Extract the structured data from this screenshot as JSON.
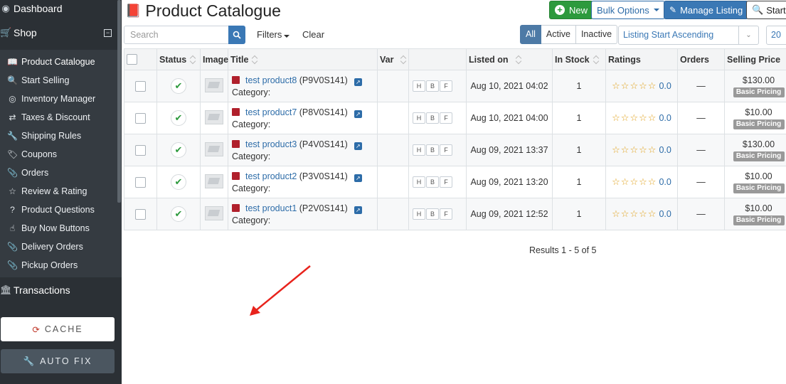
{
  "sidebar": {
    "dashboard": "Dashboard",
    "shop": "Shop",
    "items": [
      {
        "label": "Product Catalogue",
        "icon": "book-icon"
      },
      {
        "label": "Start Selling",
        "icon": "search-icon"
      },
      {
        "label": "Inventory Manager",
        "icon": "target-icon"
      },
      {
        "label": "Taxes & Discount",
        "icon": "exchange-icon"
      },
      {
        "label": "Shipping Rules",
        "icon": "wrench-icon"
      },
      {
        "label": "Coupons",
        "icon": "tag-icon"
      },
      {
        "label": "Orders",
        "icon": "paperclip-icon"
      },
      {
        "label": "Review & Rating",
        "icon": "star-half-icon"
      },
      {
        "label": "Product Questions",
        "icon": "question-icon"
      },
      {
        "label": "Buy Now Buttons",
        "icon": "hand-pointer-icon"
      },
      {
        "label": "Delivery Orders",
        "icon": "paperclip-icon"
      },
      {
        "label": "Pickup Orders",
        "icon": "paperclip-icon"
      }
    ],
    "transactions": "Transactions",
    "cache_label": "CACHE",
    "autofix_label": "AUTO FIX"
  },
  "header": {
    "title": "Product Catalogue",
    "new_label": "New",
    "bulk_label": "Bulk Options",
    "manage_label": "Manage Listing",
    "start_selling_label": "Start S"
  },
  "toolbar": {
    "search_placeholder": "Search",
    "filters_label": "Filters",
    "clear_label": "Clear",
    "status_all": "All",
    "status_active": "Active",
    "status_inactive": "Inactive",
    "sort_value": "Listing Start Ascending",
    "per_page": "20"
  },
  "table": {
    "headers": {
      "status": "Status",
      "image": "Image",
      "title": "Title",
      "var": "Var",
      "listed_on": "Listed on",
      "in_stock": "In Stock",
      "ratings": "Ratings",
      "orders": "Orders",
      "selling_price": "Selling Price"
    },
    "category_label": "Category:",
    "hbf": [
      "H",
      "B",
      "F"
    ],
    "badge": "Basic Pricing",
    "rows": [
      {
        "name": "test product8",
        "code": "(P9V0S141)",
        "listed": "Aug 10, 2021 04:02",
        "stock": "1",
        "rating": "0.0",
        "orders": "—",
        "price": "$130.00"
      },
      {
        "name": "test product7",
        "code": "(P8V0S141)",
        "listed": "Aug 10, 2021 04:00",
        "stock": "1",
        "rating": "0.0",
        "orders": "—",
        "price": "$10.00"
      },
      {
        "name": "test product3",
        "code": "(P4V0S141)",
        "listed": "Aug 09, 2021 13:37",
        "stock": "1",
        "rating": "0.0",
        "orders": "—",
        "price": "$130.00"
      },
      {
        "name": "test product2",
        "code": "(P3V0S141)",
        "listed": "Aug 09, 2021 13:20",
        "stock": "1",
        "rating": "0.0",
        "orders": "—",
        "price": "$10.00"
      },
      {
        "name": "test product1",
        "code": "(P2V0S141)",
        "listed": "Aug 09, 2021 12:52",
        "stock": "1",
        "rating": "0.0",
        "orders": "—",
        "price": "$10.00"
      }
    ]
  },
  "results": "Results 1 - 5 of 5",
  "colors": {
    "sidebar_bg": "#2b3035",
    "submenu_bg": "#353b41",
    "primary": "#3a78b5",
    "success": "#2d9a3d",
    "star": "#e0a11b",
    "arrow": "#e8231c"
  }
}
